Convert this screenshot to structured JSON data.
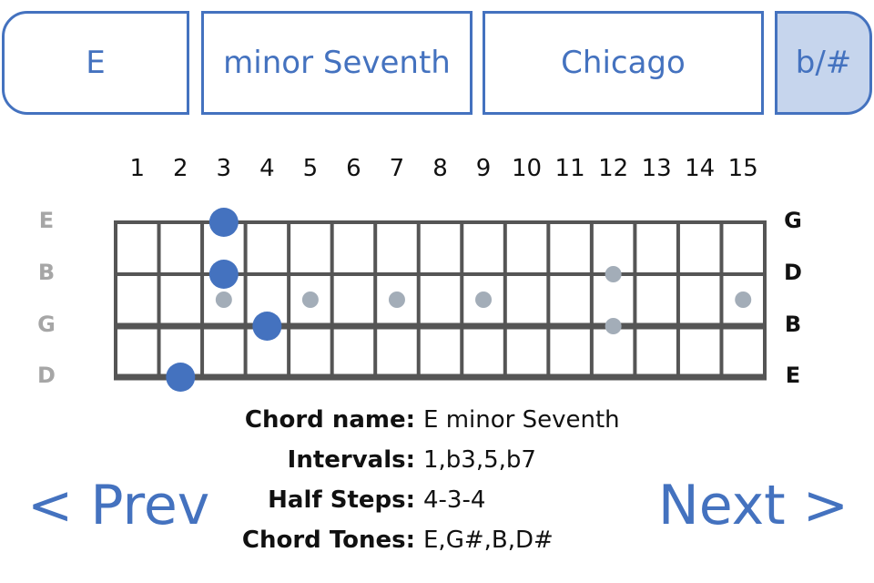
{
  "selectors": {
    "root": "E",
    "quality": "minor Seventh",
    "voicing": "Chicago",
    "accidental": "b/#"
  },
  "fretboard": {
    "fret_numbers": [
      "1",
      "2",
      "3",
      "4",
      "5",
      "6",
      "7",
      "8",
      "9",
      "10",
      "11",
      "12",
      "13",
      "14",
      "15"
    ],
    "left_string_labels": [
      "E",
      "B",
      "G",
      "D"
    ],
    "right_string_labels": [
      "G",
      "D",
      "B",
      "E"
    ],
    "chord_notes": [
      {
        "string": 1,
        "fret": 3
      },
      {
        "string": 2,
        "fret": 3
      },
      {
        "string": 3,
        "fret": 4
      },
      {
        "string": 4,
        "fret": 2
      }
    ],
    "inlay_markers": [
      {
        "fret": 3,
        "type": "single"
      },
      {
        "fret": 5,
        "type": "single"
      },
      {
        "fret": 7,
        "type": "single"
      },
      {
        "fret": 9,
        "type": "single"
      },
      {
        "fret": 12,
        "type": "double"
      },
      {
        "fret": 15,
        "type": "single"
      }
    ],
    "colors": {
      "note": "#4472bf",
      "inlay": "#a3adb8",
      "grid": "#555555"
    }
  },
  "info": {
    "chord_name_label": "Chord name:",
    "chord_name": "E minor Seventh",
    "intervals_label": "Intervals:",
    "intervals": "1,b3,5,b7",
    "half_steps_label": "Half Steps:",
    "half_steps": "4-3-4",
    "chord_tones_label": "Chord Tones:",
    "chord_tones": "E,G#,B,D#"
  },
  "nav": {
    "prev": "< Prev",
    "next": "Next >"
  }
}
